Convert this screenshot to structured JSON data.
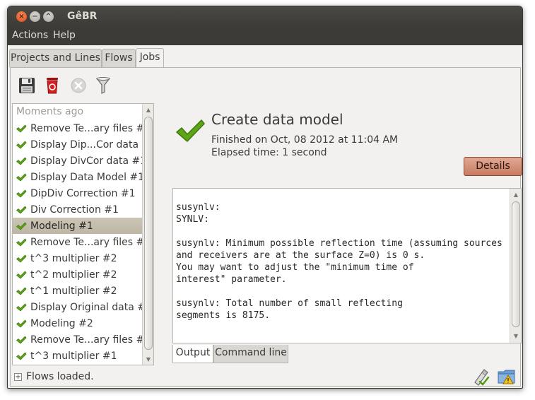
{
  "window": {
    "title": "GêBR",
    "close_glyph": "×",
    "min_glyph": "−",
    "max_glyph": "^"
  },
  "menu": {
    "items": [
      "Actions",
      "Help"
    ]
  },
  "tabs": [
    {
      "label": "Projects and Lines",
      "active": false
    },
    {
      "label": "Flows",
      "active": false
    },
    {
      "label": "Jobs",
      "active": true
    }
  ],
  "toolbar": {
    "icons": [
      "save-icon",
      "delete-icon",
      "cancel-icon",
      "filter-icon"
    ]
  },
  "jobs_list": {
    "group_header": "Moments ago",
    "items": [
      {
        "label": "Remove Te...ary files #1",
        "selected": false
      },
      {
        "label": "Display Dip...Cor data #1",
        "selected": false
      },
      {
        "label": "Display DivCor data #1",
        "selected": false
      },
      {
        "label": "Display Data Model #1",
        "selected": false
      },
      {
        "label": "DipDiv Correction #1",
        "selected": false
      },
      {
        "label": "Div Correction #1",
        "selected": false
      },
      {
        "label": "Modeling #1",
        "selected": true
      },
      {
        "label": "Remove Te...ary files #2",
        "selected": false
      },
      {
        "label": "t^3 multiplier #2",
        "selected": false
      },
      {
        "label": "t^2 multiplier #2",
        "selected": false
      },
      {
        "label": "t^1 multiplier #2",
        "selected": false
      },
      {
        "label": "Display Original data #2",
        "selected": false
      },
      {
        "label": "Modeling #2",
        "selected": false
      },
      {
        "label": "Remove Te...ary files #1",
        "selected": false
      },
      {
        "label": "t^3 multiplier #1",
        "selected": false
      }
    ]
  },
  "job_detail": {
    "title": "Create data model",
    "finished": "Finished on Oct, 08 2012 at 11:04 AM",
    "elapsed": "Elapsed time: 1 second",
    "details_button": "Details",
    "output_text": "susynlv:\nSYNLV:\n\nsusynlv: Minimum possible reflection time (assuming sources\nand receivers are at the surface Z=0) is 0 s.\nYou may want to adjust the \"minimum time of\ninterest\" parameter.\n\nsusynlv: Total number of small reflecting\nsegments is 8175.",
    "bottom_tabs": [
      {
        "label": "Output",
        "active": true
      },
      {
        "label": "Command line",
        "active": false
      }
    ]
  },
  "statusbar": {
    "expander_glyph": "+",
    "text": "Flows loaded."
  },
  "colors": {
    "check_green": "#4e9a06",
    "details_button": "#d4907a",
    "selected_row": "#c4bdab"
  }
}
